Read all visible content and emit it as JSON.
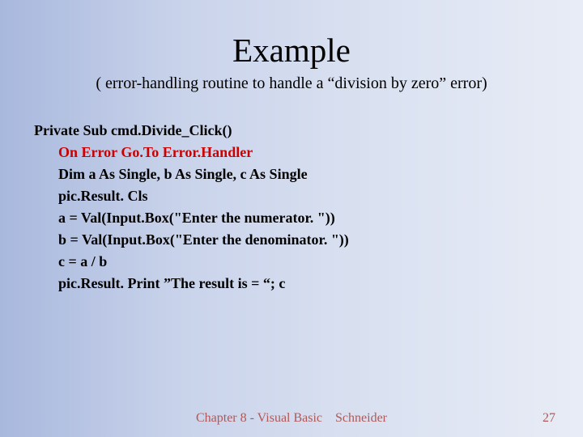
{
  "title": "Example",
  "subtitle": "( error-handling routine to handle a “division by zero” error)",
  "code": {
    "l1": "Private Sub cmd.Divide_Click()",
    "l2": "On Error Go.To Error.Handler",
    "l3": "Dim a As Single, b As Single, c As Single",
    "l4": "pic.Result. Cls",
    "l5": "a = Val(Input.Box(\"Enter the numerator. \"))",
    "l6": "b = Val(Input.Box(\"Enter the denominator. \"))",
    "l7": "c = a / b",
    "l8": "pic.Result. Print ”The result is = “; c"
  },
  "footer": "Chapter 8 - Visual Basic    Schneider",
  "page": "27"
}
